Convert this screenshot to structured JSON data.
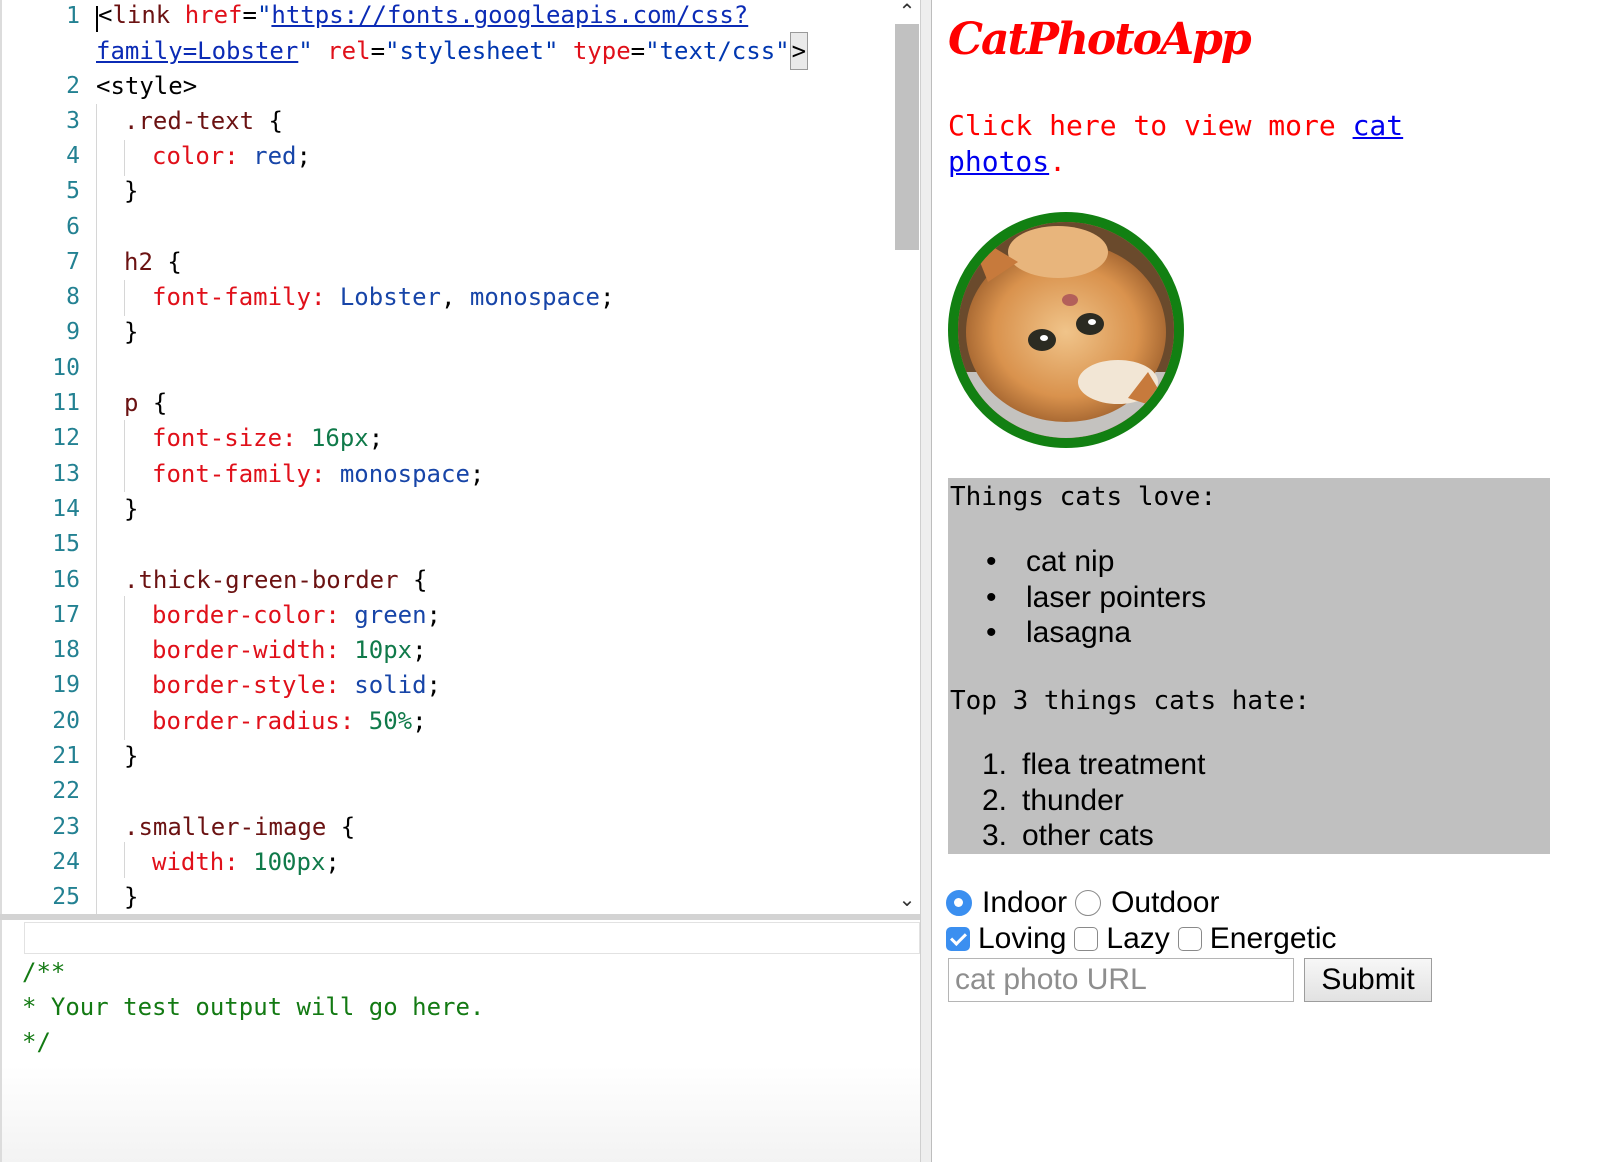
{
  "editor": {
    "line_numbers": [
      "1",
      "2",
      "3",
      "4",
      "5",
      "6",
      "7",
      "8",
      "9",
      "10",
      "11",
      "12",
      "13",
      "14",
      "15",
      "16",
      "17",
      "18",
      "19",
      "20",
      "21",
      "22",
      "23",
      "24",
      "25"
    ],
    "line1": {
      "open": "<",
      "tag": "link",
      "sp1": " ",
      "href_attr": "href",
      "eq": "=",
      "q": "\"",
      "href_value_part1": "https://fonts.googleapis.com/css?",
      "href_value_part2": "family=Lobster",
      "rel_attr": "rel",
      "rel_value": "\"stylesheet\"",
      "type_attr": "type",
      "type_value": "\"text/css\"",
      "close": ">"
    },
    "style_tag": "<style>",
    "rules": {
      "red_text_selector": ".red-text",
      "brace_open": "{",
      "brace_close": "}",
      "color_prop": "color:",
      "color_val": "red",
      "semi": ";",
      "h2_selector": "h2",
      "font_family_prop": "font-family:",
      "lobster_val": "Lobster",
      "comma": ",",
      "monospace_val": "monospace",
      "p_selector": "p",
      "font_size_prop": "font-size:",
      "font_size_val": "16px",
      "thick_selector": ".thick-green-border",
      "border_color_prop": "border-color:",
      "border_color_val": "green",
      "border_width_prop": "border-width:",
      "border_width_val": "10px",
      "border_style_prop": "border-style:",
      "border_style_val": "solid",
      "border_radius_prop": "border-radius:",
      "border_radius_val": "50%",
      "smaller_selector": ".smaller-image",
      "width_prop": "width:",
      "width_val": "100px"
    },
    "scroll_up_icon": "⌃",
    "scroll_down_icon": "⌄"
  },
  "output": {
    "lines": [
      "/**",
      "* Your test output will go here.",
      "*/"
    ]
  },
  "preview": {
    "title": "CatPhotoApp",
    "intro_text": "Click here to view more ",
    "intro_link": "cat photos",
    "intro_end": ".",
    "things_love_label": "Things cats love:",
    "love_items": [
      "cat nip",
      "laser pointers",
      "lasagna"
    ],
    "things_hate_label": "Top 3 things cats hate:",
    "hate_items": [
      "flea treatment",
      "thunder",
      "other cats"
    ],
    "radio_options": [
      {
        "label": "Indoor",
        "checked": true
      },
      {
        "label": "Outdoor",
        "checked": false
      }
    ],
    "checkbox_options": [
      {
        "label": "Loving",
        "checked": true
      },
      {
        "label": "Lazy",
        "checked": false
      },
      {
        "label": "Energetic",
        "checked": false
      }
    ],
    "url_placeholder": "cat photo URL",
    "submit_label": "Submit",
    "colors": {
      "title": "#ff0000",
      "link": "#0000ee",
      "border": "#128012",
      "list_bg": "#c0c0c0",
      "accent": "#3b8ff0"
    }
  }
}
